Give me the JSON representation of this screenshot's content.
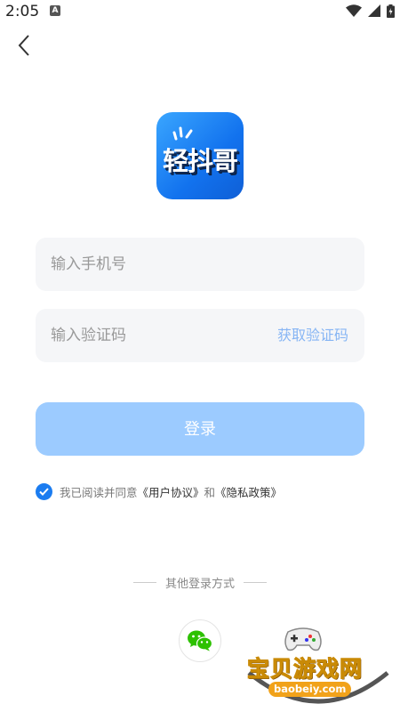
{
  "status_bar": {
    "time": "2:05",
    "notification_icon": "A"
  },
  "icons": {
    "back": "chevron-left-icon",
    "wifi": "wifi-icon",
    "signal": "signal-icon",
    "battery": "battery-icon",
    "check": "check-icon",
    "wechat": "wechat-icon"
  },
  "logo": {
    "text": "轻抖哥"
  },
  "form": {
    "phone_placeholder": "输入手机号",
    "code_placeholder": "输入验证码",
    "get_code_label": "获取验证码",
    "login_label": "登录"
  },
  "agreement": {
    "prefix": "我已阅读并同意",
    "user_agreement": "《用户协议》",
    "and": "和",
    "privacy_policy": "《隐私政策》",
    "checked": true
  },
  "other_login": {
    "label": "其他登录方式"
  },
  "watermark": {
    "cn": "宝贝游戏网",
    "url": "baobeiy.com"
  },
  "colors": {
    "accent": "#1b7cf0",
    "login_button": "#9ccbff",
    "get_code": "#86b5f4",
    "field_bg": "#f5f6f8",
    "wechat": "#2dc100"
  }
}
